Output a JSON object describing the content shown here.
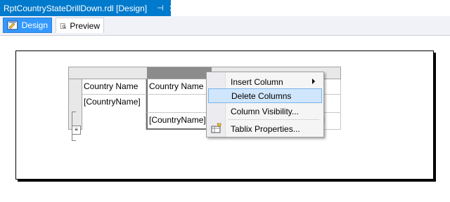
{
  "doc_tab": {
    "title": "RptCountryStateDrillDown.rdl [Design]",
    "pin_glyph": "⊣",
    "close_glyph": "✕"
  },
  "view_tabs": {
    "design_label": "Design",
    "preview_label": "Preview"
  },
  "tablix": {
    "cells": {
      "r1c1": "Country Name",
      "r1c2": "Country Name",
      "r2c1": "[CountryName]",
      "r3c2": "[CountryName]",
      "r3c_right": "]"
    }
  },
  "context_menu": {
    "items": [
      {
        "label": "Insert Column",
        "has_submenu": true
      },
      {
        "label": "Delete Columns",
        "highlighted": true
      },
      {
        "label": "Column Visibility..."
      },
      {
        "label": "Tablix Properties..."
      }
    ]
  },
  "colors": {
    "accent_tab": "#007acc",
    "design_button": "#3399ff",
    "menu_highlight": "#cfe6fc"
  }
}
